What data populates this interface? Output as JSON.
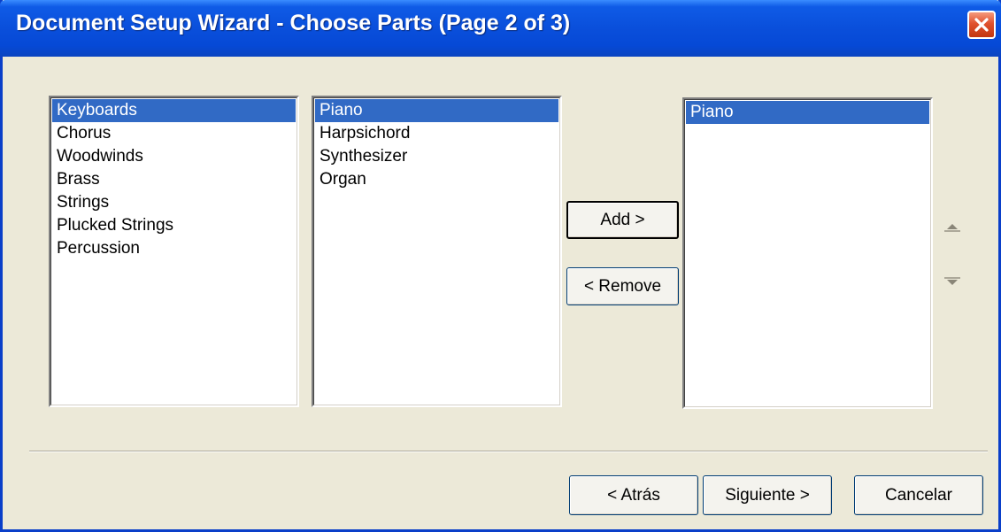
{
  "window": {
    "title": "Document Setup Wizard - Choose Parts (Page 2 of 3)"
  },
  "lists": {
    "families": {
      "items": [
        "Keyboards",
        "Chorus",
        "Woodwinds",
        "Brass",
        "Strings",
        "Plucked Strings",
        "Percussion"
      ],
      "selected_index": 0
    },
    "instruments": {
      "items": [
        "Piano",
        "Harpsichord",
        "Synthesizer",
        "Organ"
      ],
      "selected_index": 0
    },
    "chosen": {
      "items": [
        "Piano"
      ],
      "selected_index": 0
    }
  },
  "buttons": {
    "add": "Add >",
    "remove": "< Remove",
    "back": "< Atrás",
    "next": "Siguiente >",
    "cancel": "Cancelar"
  },
  "icons": {
    "close": "close-icon",
    "move_up": "triangle-up-icon",
    "move_down": "triangle-down-icon"
  },
  "colors": {
    "selection": "#316ac5",
    "titlebar": "#0a4fdb",
    "close": "#e0512e",
    "dialog_bg": "#ece9d8"
  }
}
